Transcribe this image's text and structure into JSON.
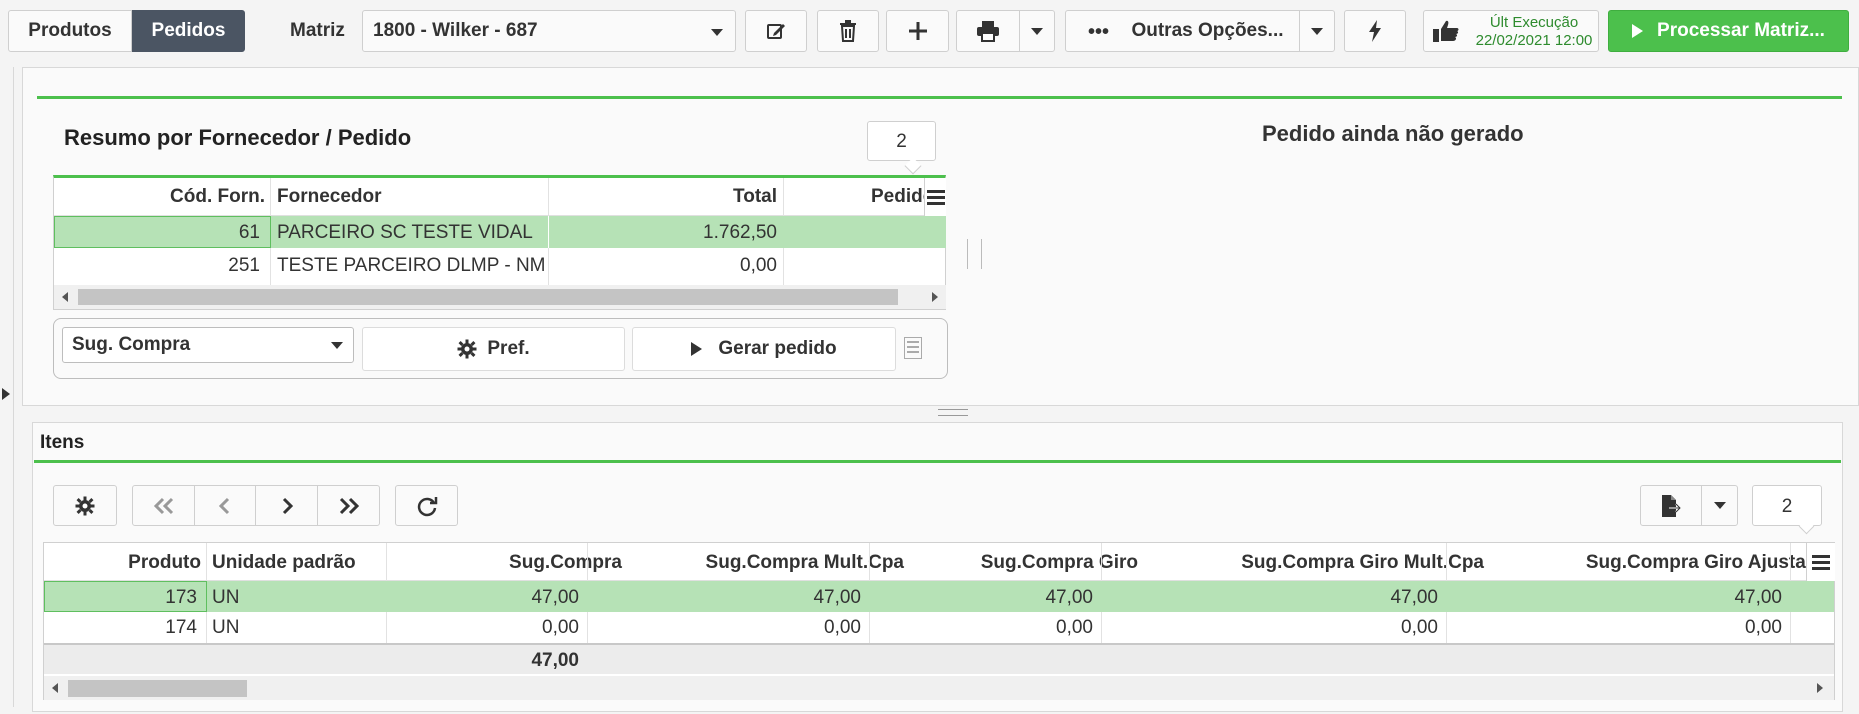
{
  "toolbar": {
    "tab_produtos": "Produtos",
    "tab_pedidos": "Pedidos",
    "matriz_label": "Matriz",
    "matriz_value": "1800 - Wilker - 687",
    "outras_opcoes": "Outras Opções...",
    "ult_exec_label": "Últ Execução",
    "ult_exec_date": "22/02/2021 12:00",
    "processar": "Processar Matriz..."
  },
  "resumo": {
    "title": "Resumo por Fornecedor / Pedido",
    "count_badge": "2",
    "columns": [
      "Cód. Forn.",
      "Fornecedor",
      "Total",
      "Pedido"
    ],
    "rows": [
      {
        "cod": "61",
        "fornecedor": "PARCEIRO SC TESTE VIDAL",
        "total": "1.762,50",
        "pedido": ""
      },
      {
        "cod": "251",
        "fornecedor": "TESTE PARCEIRO DLMP - NM",
        "total": "0,00",
        "pedido": ""
      }
    ],
    "select_value": "Sug. Compra",
    "pref_button": "Pref.",
    "gerar_button": "Gerar pedido"
  },
  "pedido_status": "Pedido ainda não gerado",
  "itens": {
    "title": "Itens",
    "count_badge": "2",
    "columns": [
      "Produto",
      "Unidade padrão",
      "Sug.Compra",
      "Sug.Compra Mult.Cpa",
      "Sug.Compra Giro",
      "Sug.Compra Giro Mult.Cpa",
      "Sug.Compra Giro Ajustado"
    ],
    "rows": [
      {
        "produto": "173",
        "unidade": "UN",
        "sug": "47,00",
        "sug_mult": "47,00",
        "giro": "47,00",
        "giro_mult": "47,00",
        "giro_ajust": "47,00"
      },
      {
        "produto": "174",
        "unidade": "UN",
        "sug": "0,00",
        "sug_mult": "0,00",
        "giro": "0,00",
        "giro_mult": "0,00",
        "giro_ajust": "0,00"
      }
    ],
    "total_sug": "47,00"
  },
  "colors": {
    "accent_green": "#4cc04c",
    "selected_row": "#b6e2b6",
    "tab_active": "#4b5563"
  }
}
